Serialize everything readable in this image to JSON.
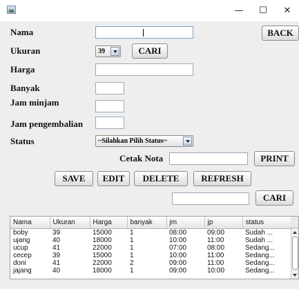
{
  "window": {
    "minimize": "—",
    "maximize": "☐",
    "close": "✕"
  },
  "labels": {
    "nama": "Nama",
    "ukuran": "Ukuran",
    "harga": "Harga",
    "banyak": "Banyak",
    "jam_minjam": "Jam minjam",
    "jam_pengembalian": "Jam pengembalian",
    "status": "Status",
    "cetak_nota": "Cetak Nota"
  },
  "inputs": {
    "nama": "",
    "harga": "",
    "banyak": "",
    "jam_minjam": "",
    "jam_pengembalian": "",
    "cetak_nota": "",
    "search": ""
  },
  "ukuran_select": {
    "value": "39"
  },
  "status_select": {
    "value": "~Silahkan Pilih Status~"
  },
  "buttons": {
    "back": "BACK",
    "cari_ukuran": "CARI",
    "print": "PRINT",
    "save": "SAVE",
    "edit": "EDIT",
    "delete": "DELETE",
    "refresh": "REFRESH",
    "cari_search": "CARI"
  },
  "table": {
    "columns": [
      "Nama",
      "Ukuran",
      "Harga",
      "banyak",
      "jm",
      "jp",
      "status"
    ],
    "rows": [
      [
        "boby",
        "39",
        "15000",
        "1",
        "08:00",
        "09:00",
        "Sudah ..."
      ],
      [
        "ujang",
        "40",
        "18000",
        "1",
        "10:00",
        "11:00",
        "Sudah ..."
      ],
      [
        "ucup",
        "41",
        "22000",
        "1",
        "07:00",
        "08:00",
        "Sedang..."
      ],
      [
        "cecep",
        "39",
        "15000",
        "1",
        "10:00",
        "11:00",
        "Sedang..."
      ],
      [
        "doni",
        "41",
        "22000",
        "2",
        "09:00",
        "11:00",
        "Sedang..."
      ],
      [
        "jajang",
        "40",
        "18000",
        "1",
        "09:00",
        "10:00",
        "Sedang..."
      ]
    ]
  }
}
